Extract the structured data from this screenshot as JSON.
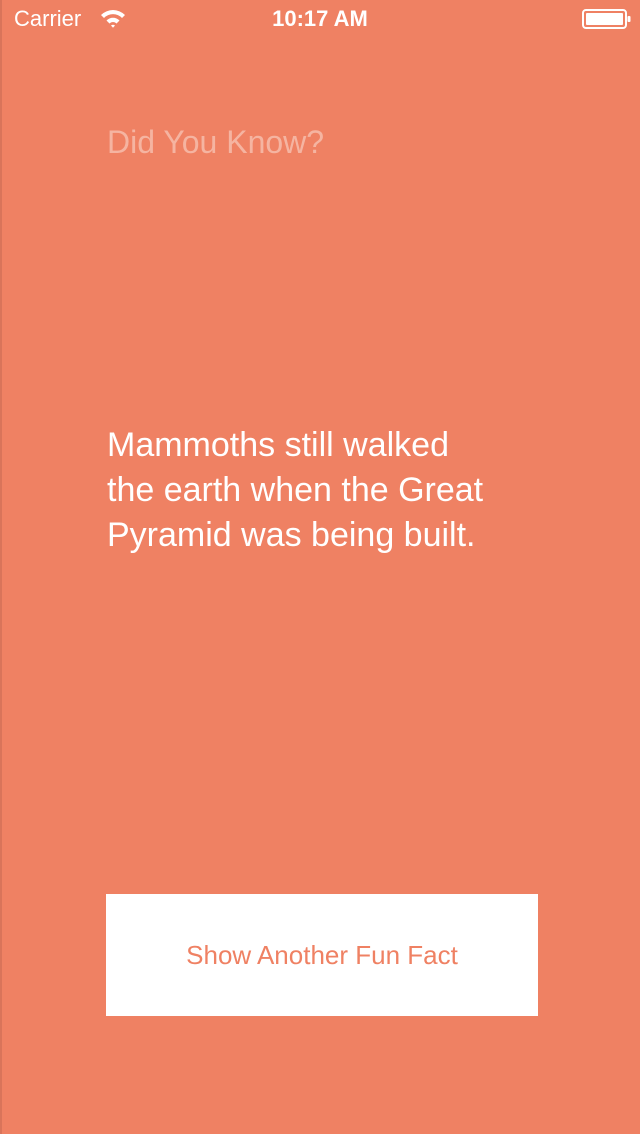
{
  "status_bar": {
    "carrier": "Carrier",
    "time": "10:17 AM",
    "wifi_icon": "wifi-icon",
    "battery_icon": "battery-icon"
  },
  "main": {
    "heading": "Did You Know?",
    "fact_lines": [
      "Mammoths still walked",
      "the earth when the Great",
      "Pyramid was being built."
    ],
    "button_label": "Show Another Fun Fact"
  },
  "colors": {
    "background": "#EF8163",
    "heading_text": "#F5B4A1",
    "fact_text": "#FFFFFF",
    "button_background": "#FFFFFF",
    "button_text": "#EF8163"
  }
}
